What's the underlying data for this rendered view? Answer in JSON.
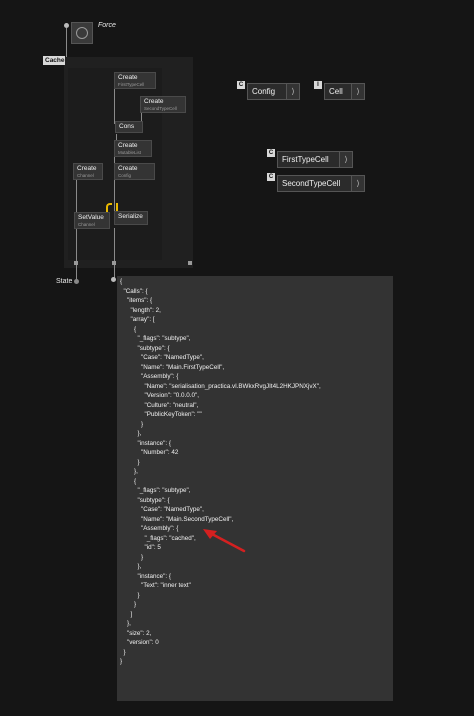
{
  "nodes": {
    "force_label": "Force",
    "cache_label": "Cache",
    "state_label": "State",
    "create_first": {
      "title": "Create",
      "sub": "FirstTypeCell"
    },
    "create_second": {
      "title": "Create",
      "sub": "SecondTypeCell"
    },
    "cons": {
      "title": "Cons"
    },
    "create_mutable": {
      "title": "Create",
      "sub": "MutableList"
    },
    "create_channel": {
      "title": "Create",
      "sub": "Channel"
    },
    "create_config": {
      "title": "Create",
      "sub": "Config"
    },
    "setvalue": {
      "title": "SetValue",
      "sub": "Channel"
    },
    "serialize": {
      "title": "Serialize"
    }
  },
  "type_nodes": [
    {
      "badge": "C",
      "name": "Config",
      "chevron": "⟩"
    },
    {
      "badge": "I",
      "name": "Cell",
      "chevron": "⟩"
    },
    {
      "badge": "C",
      "name": "FirstTypeCell",
      "chevron": "⟩"
    },
    {
      "badge": "C",
      "name": "SecondTypeCell",
      "chevron": "⟩"
    }
  ],
  "json_output": [
    "{",
    "  \"Calls\": {",
    "    \"items\": {",
    "      \"length\": 2,",
    "      \"array\": [",
    "        {",
    "          \"_flags\": \"subtype\",",
    "          \"subtype\": {",
    "            \"Case\": \"NamedType\",",
    "            \"Name\": \"Main.FirstTypeCell\",",
    "            \"Assembly\": {",
    "              \"Name\": \"serialisation_practica.vl.BWkxRvgJIt4L2HKJPNXjvX\",",
    "              \"Version\": \"0.0.0.0\",",
    "              \"Culture\": \"neutral\",",
    "              \"PublicKeyToken\": \"\"",
    "            }",
    "          },",
    "          \"instance\": {",
    "            \"Number\": 42",
    "          }",
    "        },",
    "        {",
    "          \"_flags\": \"subtype\",",
    "          \"subtype\": {",
    "            \"Case\": \"NamedType\",",
    "            \"Name\": \"Main.SecondTypeCell\",",
    "            \"Assembly\": {",
    "              \"_flags\": \"cached\",",
    "              \"id\": 5",
    "            }",
    "          },",
    "          \"instance\": {",
    "            \"Text\": \"inner text\"",
    "          }",
    "        }",
    "      ]",
    "    },",
    "    \"size\": 2,",
    "    \"version\": 0",
    "  }",
    "}"
  ],
  "colors": {
    "background": "#151515",
    "panel": "#333333",
    "arrow": "#d42020",
    "highlight_wire": "#e8b800"
  }
}
